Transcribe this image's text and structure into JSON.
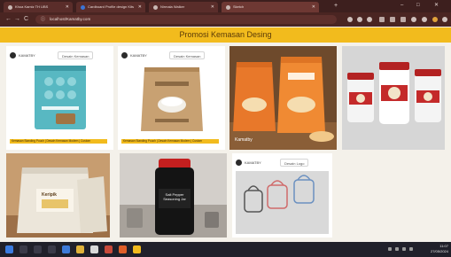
{
  "browser": {
    "tabs": [
      {
        "title": "Khoa Kamiz TH UBS"
      },
      {
        "title": "Cardboard Profile design Kits"
      },
      {
        "title": "Nirmala Walker"
      },
      {
        "title": "Sketch"
      }
    ],
    "new_tab_label": "+",
    "url": "localhost/Kamatby.com",
    "nav": {
      "back": "←",
      "forward": "→",
      "reload": "C"
    },
    "window": {
      "minimize": "–",
      "maximize": "□",
      "close": "✕"
    }
  },
  "page": {
    "banner_title": "Promosi Kemasan Desing"
  },
  "cards": [
    {
      "brand": "KAMATBY",
      "chip": "Desain Kemasan",
      "footer": "Kemasan Standing Pouch | Desain Kemasan Modern | Custom"
    },
    {
      "brand": "KAMATBY",
      "chip": "Desain Kemasan",
      "footer": "Kemasan Standing Pouch | Desain Kemasan Modern | Custom"
    },
    {
      "label": "Kamatby"
    },
    {},
    {
      "label": "Keripik"
    },
    {
      "label": "Salt Pepper Seasoning Jar"
    },
    {
      "brand": "KAMATBY",
      "chip": "Desain Logo"
    }
  ],
  "taskbar": {
    "time": "11:07",
    "date": "27/05/2024"
  },
  "colors": {
    "accent": "#f2bb1d",
    "chrome": "#3d1f1e",
    "taskbar": "#20202a"
  }
}
